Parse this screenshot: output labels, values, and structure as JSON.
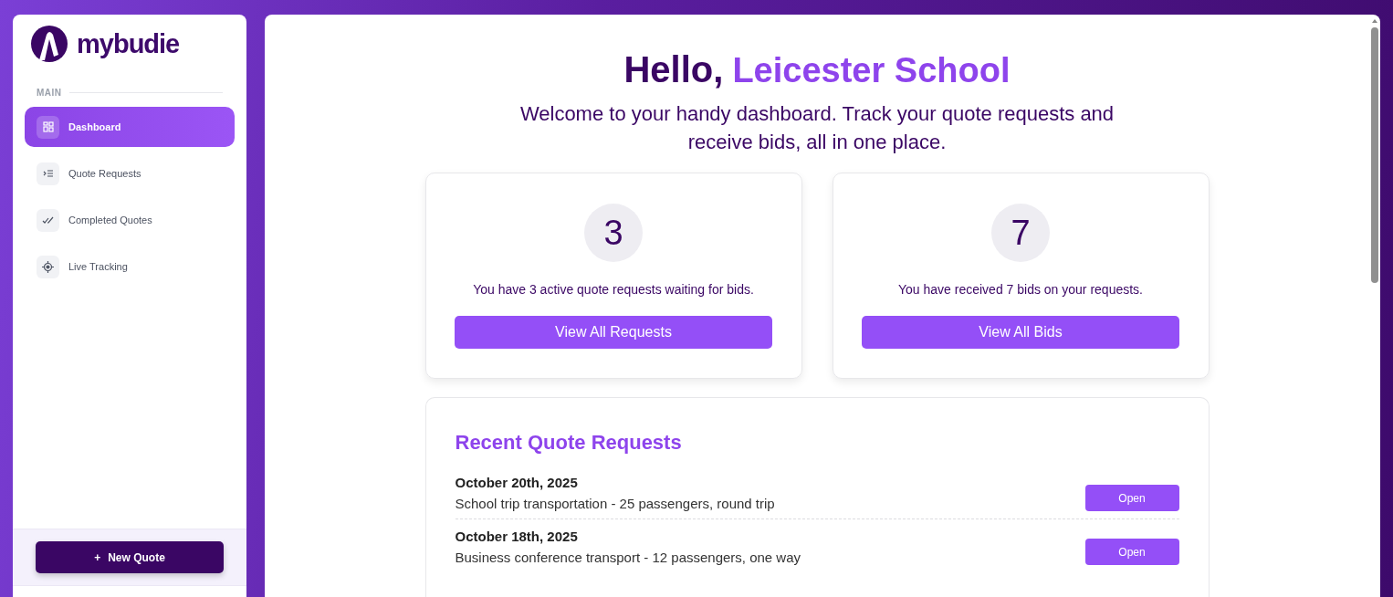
{
  "sidebar": {
    "logo": "mybudie",
    "section": "MAIN",
    "items": [
      {
        "label": "Dashboard",
        "selected": true
      },
      {
        "label": "Quote Requests",
        "selected": false
      },
      {
        "label": "Completed Quotes",
        "selected": false
      },
      {
        "label": "Live Tracking",
        "selected": false
      }
    ],
    "new_button": {
      "icon": "+",
      "label": "New Quote"
    }
  },
  "header": {
    "greeting": "Hello,",
    "name": "Leicester School",
    "subtitle": "Welcome to your handy dashboard. Track your quote requests and receive bids, all in one place."
  },
  "stats": [
    {
      "count": "3",
      "text": "You have 3 active quote requests waiting for bids.",
      "button": "View All Requests"
    },
    {
      "count": "7",
      "text": "You have received 7 bids on your requests.",
      "button": "View All Bids"
    }
  ],
  "recent": {
    "title": "Recent Quote Requests",
    "rows": [
      {
        "date": "October 20th, 2025",
        "description": "School trip transportation - 25 passengers, round trip",
        "button": "Open"
      },
      {
        "date": "October 18th, 2025",
        "description": "Business conference transport - 12 passengers, one way",
        "button": "Open"
      }
    ]
  }
}
